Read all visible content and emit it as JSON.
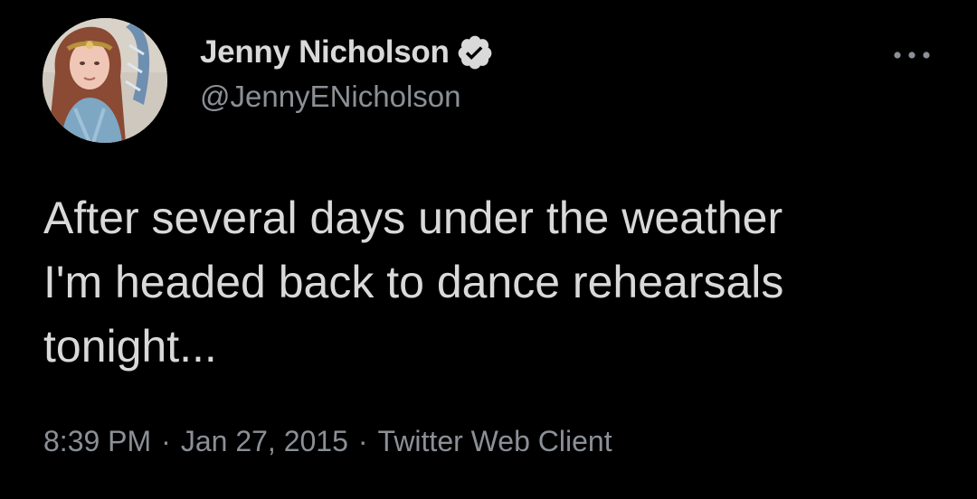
{
  "author": {
    "display_name": "Jenny Nicholson",
    "handle": "@JennyENicholson",
    "verified": true,
    "verified_icon": "verified-badge-icon",
    "avatar_icon": "profile-photo"
  },
  "menu": {
    "more_icon": "more-options-icon"
  },
  "tweet": {
    "text": "After several days under the weather\nI'm headed back to dance rehearsals\ntonight...",
    "time": "8:39 PM",
    "date": "Jan 27, 2015",
    "client": "Twitter Web Client",
    "separator": "·"
  },
  "colors": {
    "background": "#000000",
    "primary_text": "#d9d9d9",
    "secondary_text": "#8b9096"
  }
}
